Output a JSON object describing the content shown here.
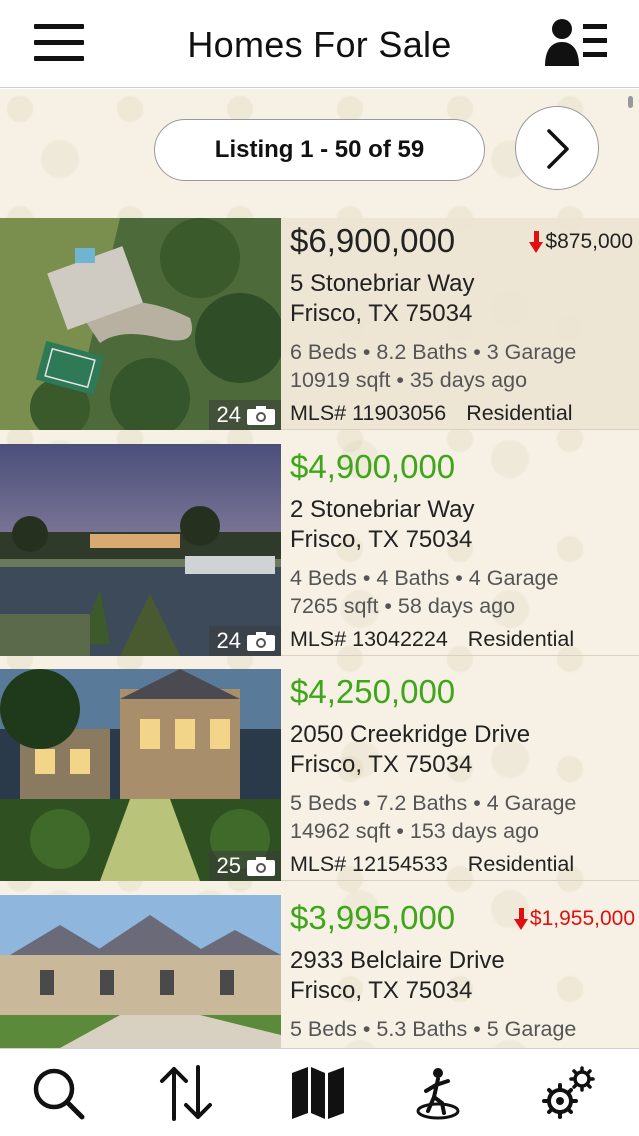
{
  "header": {
    "title": "Homes For Sale",
    "menu_icon": "hamburger-icon",
    "profile_icon": "user-list-icon"
  },
  "pagination": {
    "label": "Listing 1 - 50 of 59",
    "next_icon": "chevron-right-icon"
  },
  "listings": [
    {
      "price": "$6,900,000",
      "price_color": "#222222",
      "drop": "$875,000",
      "drop_color": "#222222",
      "address": "5  Stonebriar Way",
      "city": "Frisco, TX  75034",
      "specs": "6 Beds • 8.2 Baths • 3 Garage",
      "specs2": "10919 sqft • 35 days ago",
      "mls": "MLS# 11903056",
      "type": "Residential",
      "photos": "24"
    },
    {
      "price": "$4,900,000",
      "price_color": "#3fa51a",
      "drop": "",
      "drop_color": "",
      "address": "2  Stonebriar Way",
      "city": "Frisco, TX  75034",
      "specs": "4 Beds • 4 Baths • 4 Garage",
      "specs2": "7265 sqft • 58 days ago",
      "mls": "MLS# 13042224",
      "type": "Residential",
      "photos": "24"
    },
    {
      "price": "$4,250,000",
      "price_color": "#3fa51a",
      "drop": "",
      "drop_color": "",
      "address": "2050  Creekridge Drive",
      "city": "Frisco, TX  75034",
      "specs": "5 Beds • 7.2 Baths • 4 Garage",
      "specs2": "14962 sqft • 153 days ago",
      "mls": "MLS# 12154533",
      "type": "Residential",
      "photos": "25"
    },
    {
      "price": "$3,995,000",
      "price_color": "#3fa51a",
      "drop": "$1,955,000",
      "drop_color": "#e01010",
      "address": "2933  Belclaire Drive",
      "city": "Frisco, TX  75034",
      "specs": "5 Beds • 5.3 Baths • 5 Garage",
      "specs2": "",
      "mls": "",
      "type": "",
      "photos": ""
    }
  ],
  "tabbar": {
    "items": [
      "search-icon",
      "sort-icon",
      "map-icon",
      "open-house-icon",
      "settings-icon"
    ]
  }
}
